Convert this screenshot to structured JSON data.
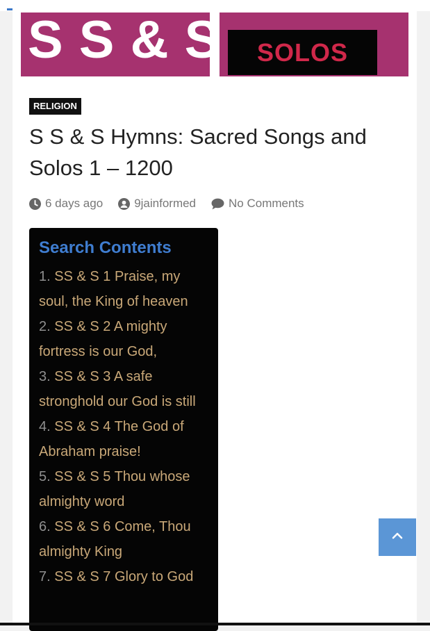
{
  "banner": {
    "left_text": "S S & S",
    "right_text": "SOLOS"
  },
  "post": {
    "category": "RELIGION",
    "title": "S S & S Hymns: Sacred Songs and Solos 1 – 1200",
    "date": "6 days ago",
    "author": "9jainformed",
    "comments": "No Comments"
  },
  "toc": {
    "heading": "Search Contents",
    "items": [
      {
        "num": "1.",
        "text": "SS & S 1  Praise, my soul, the King of heaven"
      },
      {
        "num": "2.",
        "text": "SS & S 2 A mighty fortress is our God,"
      },
      {
        "num": "3.",
        "text": "SS & S 3 A safe stronghold our God is still"
      },
      {
        "num": "4.",
        "text": "SS & S 4 The God of Abraham praise!"
      },
      {
        "num": "5.",
        "text": "SS & S 5 Thou whose almighty word"
      },
      {
        "num": "6.",
        "text": "SS & S 6 Come, Thou almighty King"
      },
      {
        "num": "7.",
        "text": "SS & S 7 Glory to God"
      }
    ]
  },
  "icons": {
    "clock": "clock-icon",
    "user": "user-icon",
    "comment": "comment-icon",
    "scroll_top": "chevron-up-icon"
  },
  "colors": {
    "banner_bg": "#a6326f",
    "solos_text": "#d0284a",
    "toc_heading": "#3f7dd0",
    "toc_link": "#c9a878",
    "scroll_top_bg": "#5b96d6"
  }
}
